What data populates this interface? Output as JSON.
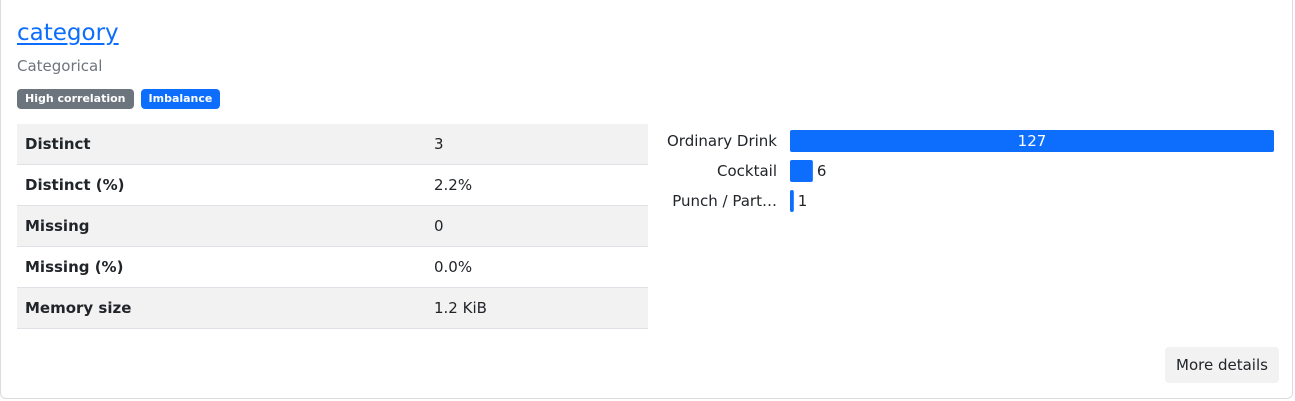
{
  "variable": {
    "name": "category",
    "type": "Categorical",
    "badges": [
      {
        "label": "High correlation",
        "color": "#6c757d"
      },
      {
        "label": "Imbalance",
        "color": "#0d6efd"
      }
    ]
  },
  "stats": [
    {
      "label": "Distinct",
      "value": "3"
    },
    {
      "label": "Distinct (%)",
      "value": "2.2%"
    },
    {
      "label": "Missing",
      "value": "0"
    },
    {
      "label": "Missing (%)",
      "value": "0.0%"
    },
    {
      "label": "Memory size",
      "value": "1.2 KiB"
    }
  ],
  "chart_data": {
    "type": "bar",
    "orientation": "horizontal",
    "categories": [
      "Ordinary Drink",
      "Cocktail",
      "Punch / Part…"
    ],
    "values": [
      127,
      6,
      1
    ],
    "bar_color": "#0d6efd",
    "title": "",
    "xlabel": "",
    "ylabel": ""
  },
  "actions": {
    "more_details": "More details"
  }
}
